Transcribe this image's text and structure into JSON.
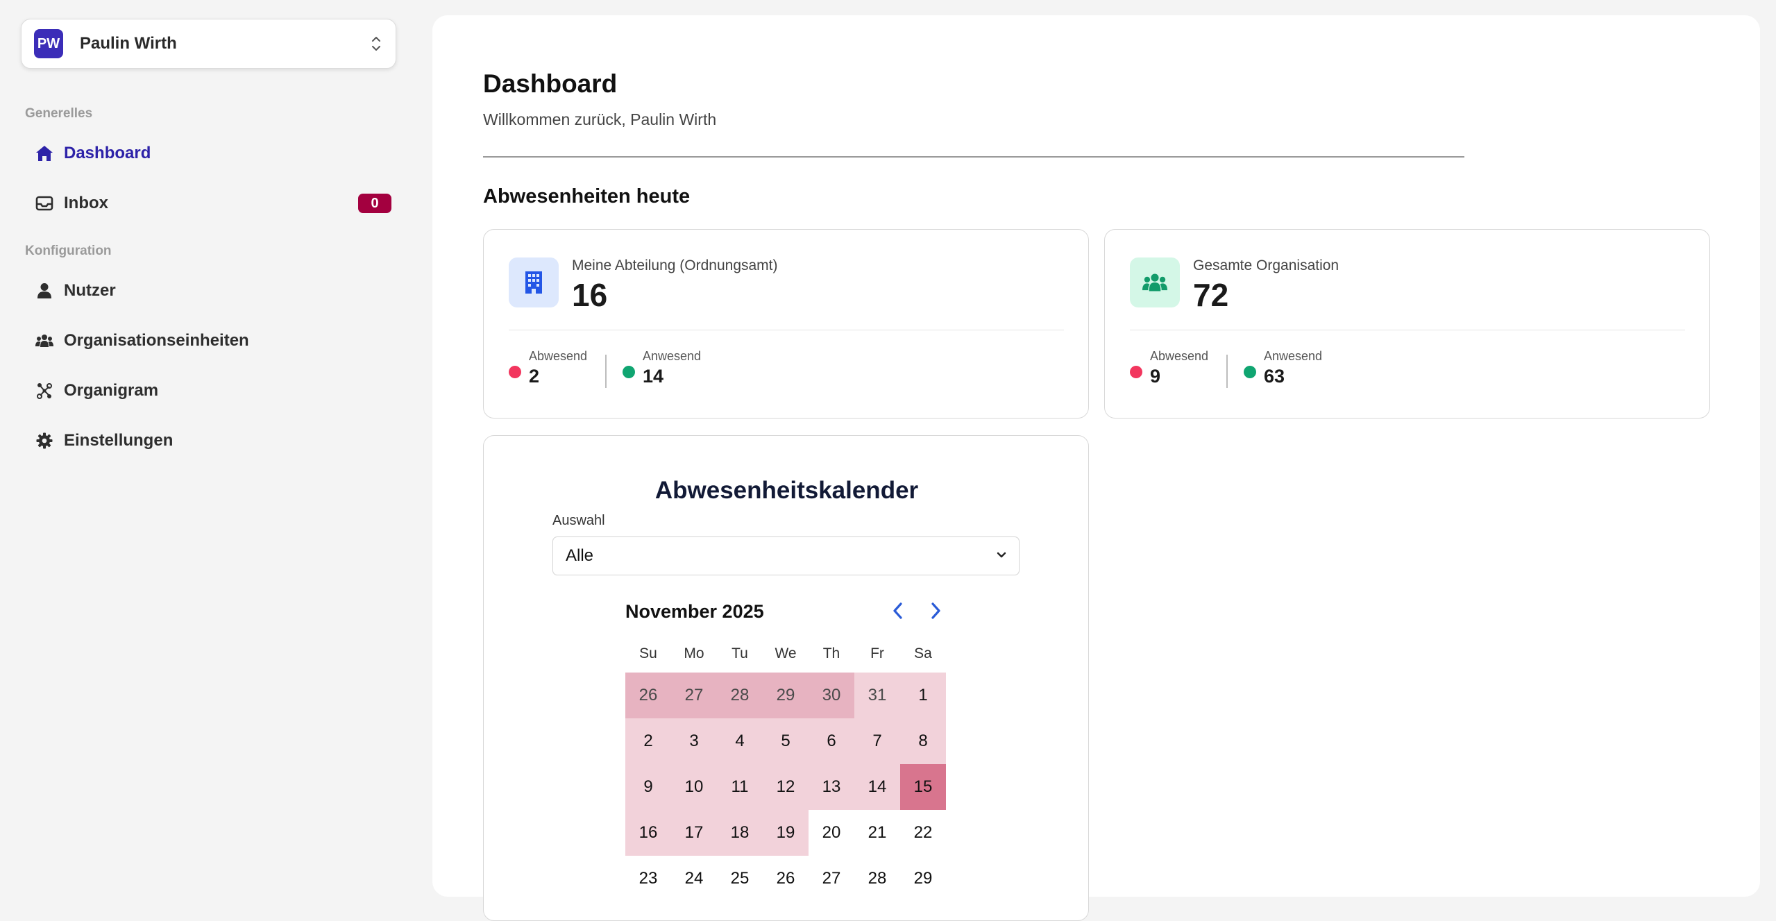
{
  "user": {
    "initials": "PW",
    "name": "Paulin Wirth"
  },
  "sidebar": {
    "sections": [
      {
        "label": "Generelles",
        "items": [
          {
            "label": "Dashboard",
            "icon": "home-icon",
            "active": true
          },
          {
            "label": "Inbox",
            "icon": "inbox-icon",
            "badge": "0"
          }
        ]
      },
      {
        "label": "Konfiguration",
        "items": [
          {
            "label": "Nutzer",
            "icon": "user-icon"
          },
          {
            "label": "Organisationseinheiten",
            "icon": "users-icon"
          },
          {
            "label": "Organigram",
            "icon": "org-chart-icon"
          },
          {
            "label": "Einstellungen",
            "icon": "gear-icon"
          }
        ]
      }
    ]
  },
  "header": {
    "title": "Dashboard",
    "subtitle": "Willkommen zurück, Paulin Wirth"
  },
  "absences": {
    "title": "Abwesenheiten heute",
    "cards": [
      {
        "label": "Meine Abteilung (Ordnungsamt)",
        "value": "16",
        "icon": "building-icon",
        "absent_label": "Abwesend",
        "absent_value": "2",
        "present_label": "Anwesend",
        "present_value": "14"
      },
      {
        "label": "Gesamte Organisation",
        "value": "72",
        "icon": "users-icon",
        "absent_label": "Abwesend",
        "absent_value": "9",
        "present_label": "Anwesend",
        "present_value": "63"
      }
    ]
  },
  "calendar": {
    "title": "Abwesenheitskalender",
    "select_label": "Auswahl",
    "select_value": "Alle",
    "month": "November 2025",
    "weekdays": [
      "Su",
      "Mo",
      "Tu",
      "We",
      "Th",
      "Fr",
      "Sa"
    ],
    "weeks": [
      [
        26,
        27,
        28,
        29,
        30,
        31,
        1
      ],
      [
        2,
        3,
        4,
        5,
        6,
        7,
        8
      ],
      [
        9,
        10,
        11,
        12,
        13,
        14,
        15
      ],
      [
        16,
        17,
        18,
        19,
        20,
        21,
        22
      ],
      [
        23,
        24,
        25,
        26,
        27,
        28,
        29
      ]
    ],
    "highlight_levels": [
      [
        "mid",
        "mid",
        "mid",
        "mid",
        "mid",
        "light",
        "light"
      ],
      [
        "light",
        "light",
        "light",
        "light",
        "light",
        "light",
        "light"
      ],
      [
        "light",
        "light",
        "light",
        "light",
        "light",
        "light",
        "strong"
      ],
      [
        "light",
        "light",
        "light",
        "light",
        "none",
        "none",
        "none"
      ],
      [
        "none",
        "none",
        "none",
        "none",
        "none",
        "none",
        "none"
      ]
    ],
    "outside_month": [
      [
        true,
        true,
        true,
        true,
        true,
        true,
        false
      ],
      [
        false,
        false,
        false,
        false,
        false,
        false,
        false
      ],
      [
        false,
        false,
        false,
        false,
        false,
        false,
        false
      ],
      [
        false,
        false,
        false,
        false,
        false,
        false,
        false
      ],
      [
        false,
        false,
        false,
        false,
        false,
        false,
        false
      ]
    ]
  },
  "colors": {
    "brand": "#3b2db8",
    "active_nav": "#2d22a8",
    "badge": "#a3003f",
    "absent_dot": "#f2365e",
    "present_dot": "#10a571",
    "building_icon": "#2356e6",
    "building_bg": "#dde8fd",
    "users_icon": "#129b6a",
    "users_bg": "#d4f7e7",
    "day_light": "#f2d2da",
    "day_mid": "#e7b3c1",
    "day_strong": "#d8758e",
    "nav_arrow": "#2a5bd7"
  }
}
